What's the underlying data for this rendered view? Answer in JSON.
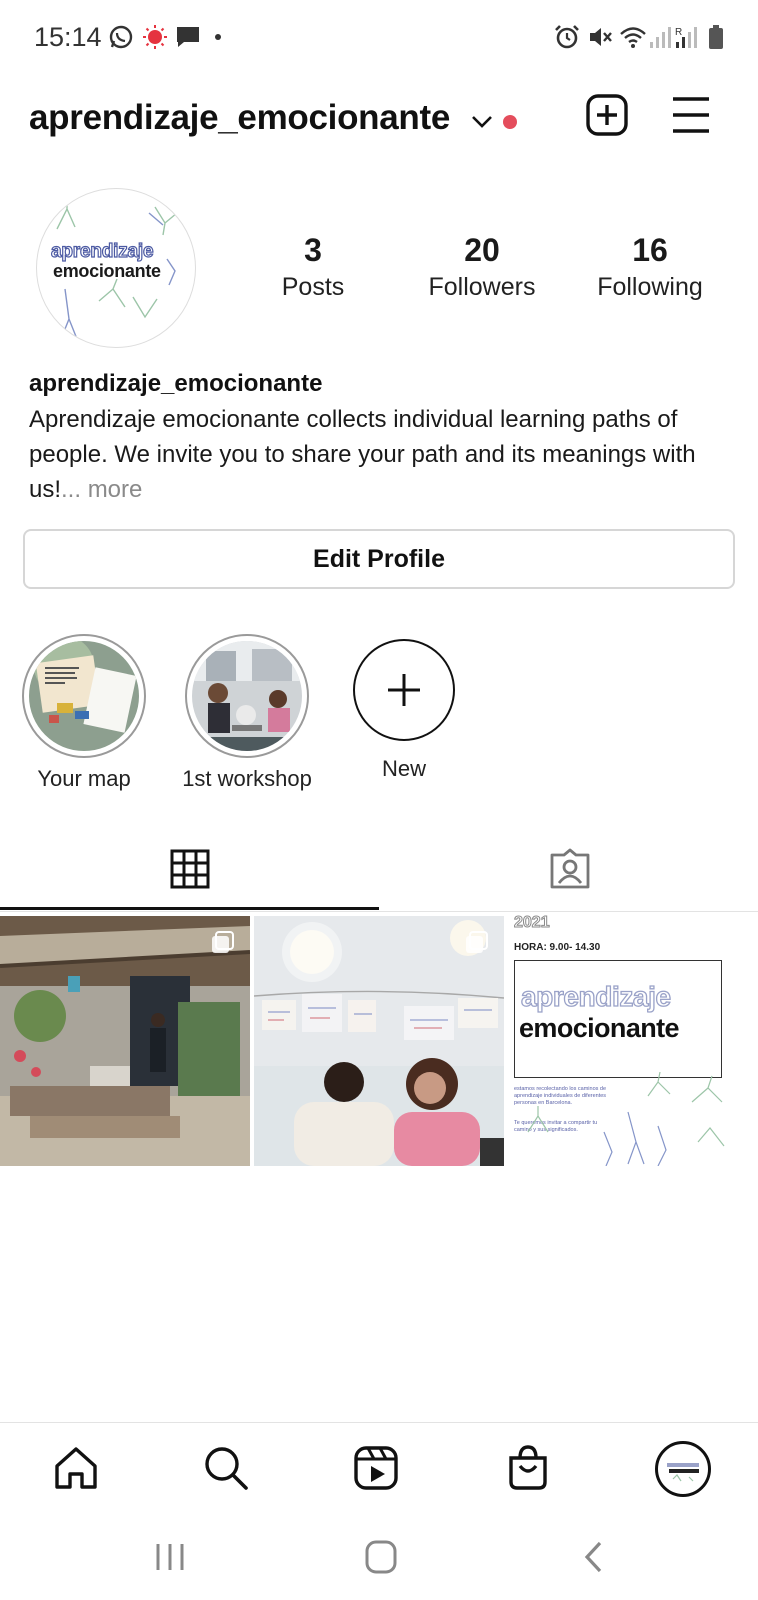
{
  "status_bar": {
    "time": "15:14",
    "left_icons": [
      "whatsapp-icon",
      "recording-icon",
      "message-icon",
      "dot-icon"
    ],
    "right_icons": [
      "alarm-icon",
      "mute-icon",
      "wifi-icon",
      "signal-icon",
      "signal-roaming-icon",
      "battery-icon"
    ]
  },
  "header": {
    "username": "aprendizaje_emocionante",
    "notification_dot_color": "#e44d5c",
    "icons": [
      "chevron-down-icon",
      "new-post-icon",
      "menu-icon"
    ]
  },
  "profile": {
    "avatar_line1": "aprendizaje",
    "avatar_line2": "emocionante",
    "stats": [
      {
        "value": "3",
        "label": "Posts"
      },
      {
        "value": "20",
        "label": "Followers"
      },
      {
        "value": "16",
        "label": "Following"
      }
    ],
    "bio_name": "aprendizaje_emocionante",
    "bio_text": "Aprendizaje emocionante collects individual learning paths of people. We invite you to share your path and its meanings with us!",
    "bio_more": "... more",
    "edit_profile_label": "Edit Profile"
  },
  "highlights": [
    {
      "label": "Your map"
    },
    {
      "label": "1st workshop"
    },
    {
      "label": "New"
    }
  ],
  "tabs": [
    "grid-icon",
    "tagged-icon"
  ],
  "posts": {
    "post3_year": "2021",
    "post3_hours": "HORA: 9.00- 14.30",
    "post3_title1": "aprendizaje",
    "post3_title2": "emocionante",
    "post3_body1": "estamos recolectando los caminos de aprendizaje individuales de diferentes personas en Barcelona.",
    "post3_body2": "Te queremos invitar a compartir tu camino y sus significados."
  },
  "bottom_nav": [
    "home-icon",
    "search-icon",
    "reels-icon",
    "shop-icon",
    "profile-avatar"
  ],
  "system_nav": [
    "recent-apps-button",
    "home-button",
    "back-button"
  ]
}
